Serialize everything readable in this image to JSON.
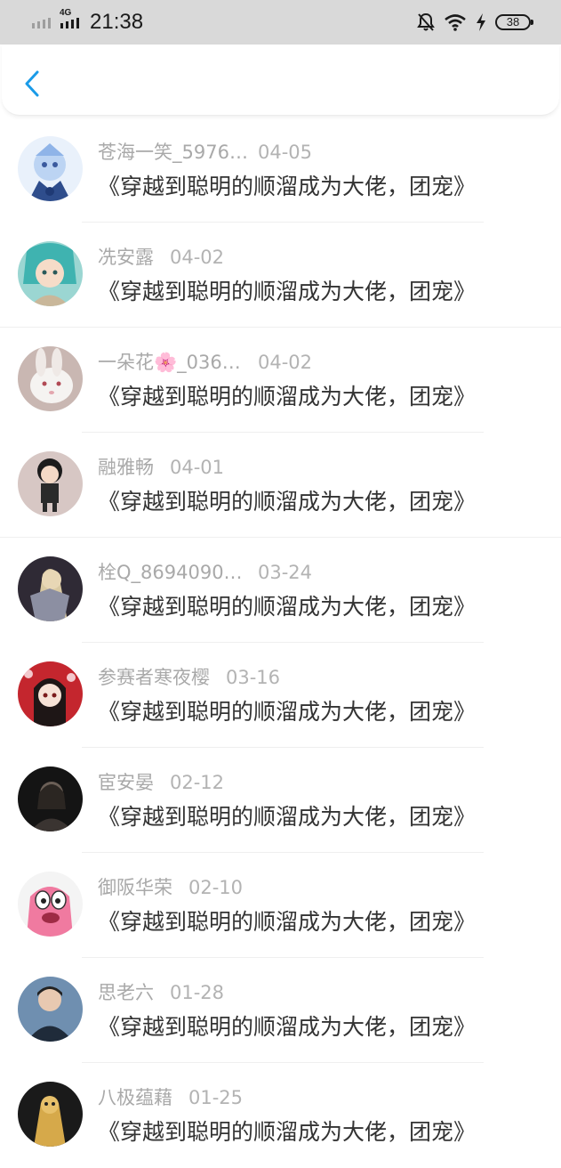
{
  "status_bar": {
    "network": "4G",
    "time": "21:38",
    "battery": "38",
    "icons": [
      "signal-icon",
      "bell-off-icon",
      "wifi-icon",
      "charging-icon",
      "battery-icon"
    ]
  },
  "nav": {
    "back_icon": "chevron-left-icon",
    "accent_color": "#1a9be8"
  },
  "comments": [
    {
      "username": "苍海一笑_5976…",
      "date": "04-05",
      "content": "《穿越到聪明的顺溜成为大佬，团宠》"
    },
    {
      "username": "冼安露",
      "date": "04-02",
      "content": "《穿越到聪明的顺溜成为大佬，团宠》"
    },
    {
      "username": "一朵花🌸_036…",
      "date": "04-02",
      "content": "《穿越到聪明的顺溜成为大佬，团宠》"
    },
    {
      "username": "融雅畅",
      "date": "04-01",
      "content": "《穿越到聪明的顺溜成为大佬，团宠》"
    },
    {
      "username": "栓Q_8694090…",
      "date": "03-24",
      "content": "《穿越到聪明的顺溜成为大佬，团宠》"
    },
    {
      "username": "参赛者寒夜樱",
      "date": "03-16",
      "content": "《穿越到聪明的顺溜成为大佬，团宠》"
    },
    {
      "username": "宦安晏",
      "date": "02-12",
      "content": "《穿越到聪明的顺溜成为大佬，团宠》"
    },
    {
      "username": "御阪华荣",
      "date": "02-10",
      "content": "《穿越到聪明的顺溜成为大佬，团宠》"
    },
    {
      "username": "思老六",
      "date": "01-28",
      "content": "《穿越到聪明的顺溜成为大佬，团宠》"
    },
    {
      "username": "八极蕴藉",
      "date": "01-25",
      "content": "《穿越到聪明的顺溜成为大佬，团宠》"
    }
  ],
  "colors": {
    "status_bar_bg": "#d9d9d9",
    "username": "#a9a9a9",
    "content": "#333333",
    "divider": "#efefef"
  }
}
